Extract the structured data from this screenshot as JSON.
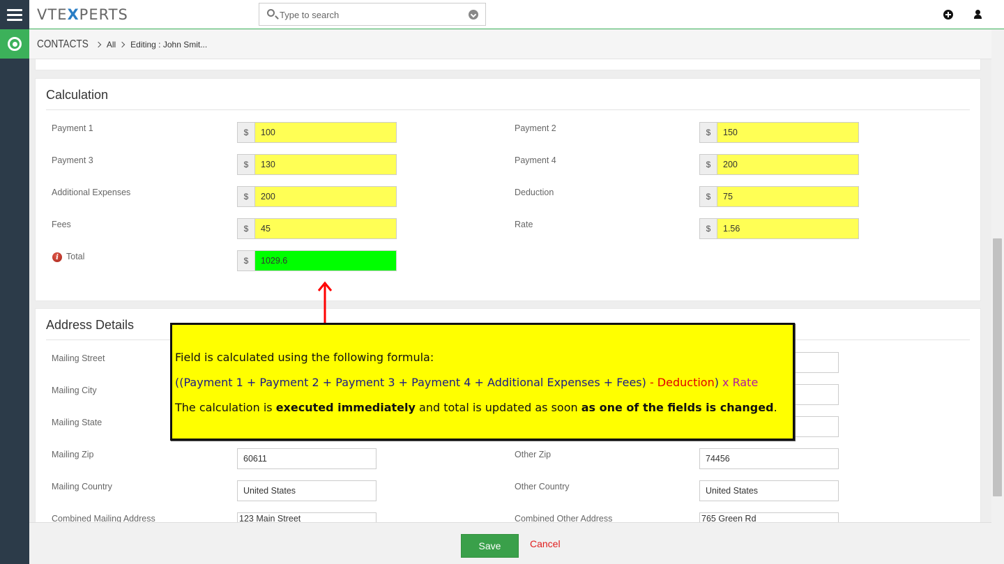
{
  "app": {
    "logo_left": "VTE",
    "logo_x": "X",
    "logo_right": "PERTS"
  },
  "search": {
    "placeholder": "Type to search"
  },
  "breadcrumb": {
    "module": "CONTACTS",
    "filter": "All",
    "record": "Editing : John Smit..."
  },
  "calculation": {
    "title": "Calculation",
    "currency": "$",
    "fields": {
      "payment1": {
        "label": "Payment 1",
        "value": "100"
      },
      "payment2": {
        "label": "Payment 2",
        "value": "150"
      },
      "payment3": {
        "label": "Payment 3",
        "value": "130"
      },
      "payment4": {
        "label": "Payment 4",
        "value": "200"
      },
      "additional": {
        "label": "Additional Expenses",
        "value": "200"
      },
      "deduction": {
        "label": "Deduction",
        "value": "75"
      },
      "fees": {
        "label": "Fees",
        "value": "45"
      },
      "rate": {
        "label": "Rate",
        "value": "1.56"
      },
      "total": {
        "label": "Total",
        "value": "1029.6"
      }
    },
    "colors": {
      "input_highlight": "#ffff55",
      "total_highlight": "#00ff00"
    }
  },
  "address": {
    "title": "Address Details",
    "mailing_street_label": "Mailing Street",
    "mailing_city_label": "Mailing City",
    "mailing_state_label": "Mailing State",
    "mailing_zip_label": "Mailing Zip",
    "mailing_zip": "60611",
    "other_zip_label": "Other Zip",
    "other_zip": "74456",
    "mailing_country_label": "Mailing Country",
    "mailing_country": "United States",
    "other_country_label": "Other Country",
    "other_country": "United States",
    "combined_mailing_label": "Combined Mailing Address",
    "combined_mailing": "123 Main Street",
    "combined_other_label": "Combined Other Address",
    "combined_other": "765 Green Rd"
  },
  "footer": {
    "save_label": "Save",
    "cancel_label": "Cancel"
  },
  "annotation": {
    "line1": "Field is calculated using the following formula:",
    "line2_main": "((Payment 1 + Payment 2 + Payment 3 + Payment 4 + Additional Expenses + Fees)",
    "line2_deduction": " - Deduction",
    "line2_close": ")",
    "line2_rate": " x Rate",
    "line3_a": "The calculation is ",
    "line3_b": "executed immediately",
    "line3_c": " and total is updated as soon ",
    "line3_d": "as one of the fields is changed",
    "line3_e": ".",
    "colors": {
      "box": "#ffff00",
      "arrow": "#ff0000",
      "deduction": "#e00000",
      "rate": "#b01aa0"
    }
  }
}
